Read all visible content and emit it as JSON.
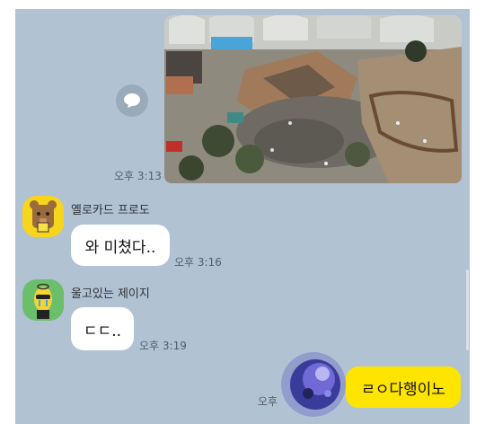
{
  "messages": [
    {
      "time": "오후 3:13"
    },
    {
      "sender": "옐로카드 프로도",
      "text": "와 미쳤다..",
      "time": "오후 3:16"
    },
    {
      "sender": "울고있는 제이지",
      "text": "ㄷㄷ..",
      "time": "오후 3:19"
    },
    {
      "text": "ㄹㅇ다행이노",
      "time": "오후"
    }
  ],
  "icons": {
    "share": "share-speech-icon"
  },
  "colors": {
    "chat_bg": "#b1c2d3",
    "my_bubble": "#fee500",
    "their_bubble": "#ffffff"
  }
}
